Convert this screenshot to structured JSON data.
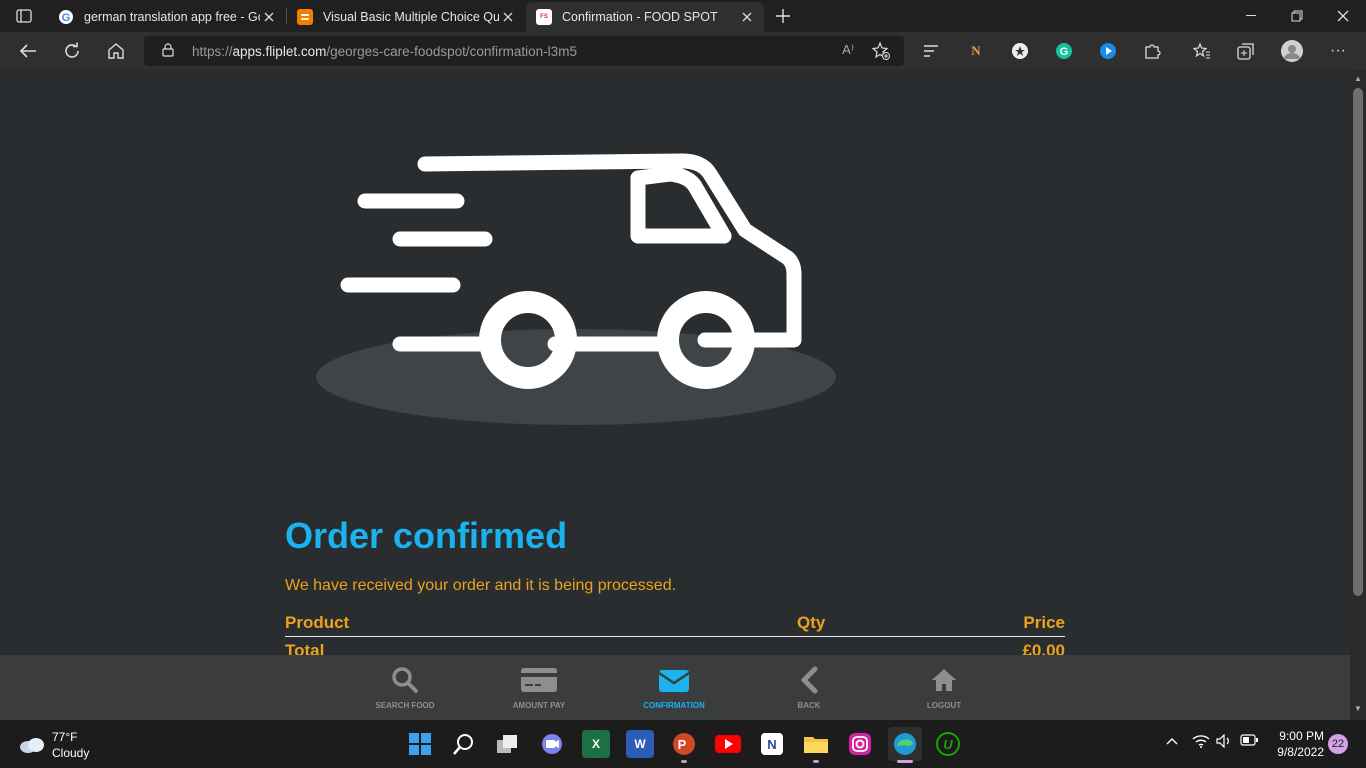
{
  "browser": {
    "tabs": [
      {
        "title": "german translation app free - Go",
        "favicon": "google-icon",
        "active": false
      },
      {
        "title": "Visual Basic Multiple Choice Que",
        "favicon": "blogger-icon",
        "active": false
      },
      {
        "title": "Confirmation - FOOD SPOT",
        "favicon": "foodspot-icon",
        "active": true
      }
    ],
    "url_prefix": "https://",
    "url_domain": "apps.fliplet.com",
    "url_path": "/georges-care-foodspot/confirmation-l3m5",
    "read_aloud_label": "A⁾"
  },
  "page": {
    "title": "Order confirmed",
    "message": "We have received your order and it is being processed.",
    "table": {
      "headers": {
        "product": "Product",
        "qty": "Qty",
        "price": "Price"
      },
      "total_label": "Total",
      "total_value": "£0.00"
    }
  },
  "app_nav": {
    "items": [
      {
        "label": "SEARCH FOOD",
        "icon": "search-icon",
        "active": false
      },
      {
        "label": "AMOUNT PAY",
        "icon": "credit-card-icon",
        "active": false
      },
      {
        "label": "CONFIRMATION",
        "icon": "envelope-icon",
        "active": true
      },
      {
        "label": "BACK",
        "icon": "chevron-left-icon",
        "active": false
      },
      {
        "label": "LOGOUT",
        "icon": "home-icon",
        "active": false
      }
    ]
  },
  "taskbar": {
    "weather_temp": "77°F",
    "weather_desc": "Cloudy",
    "time": "9:00 PM",
    "date": "9/8/2022",
    "notifications": "22"
  },
  "colors": {
    "accent_blue": "#1ab3ee",
    "accent_orange": "#eba31e",
    "page_bg": "#292d30"
  }
}
